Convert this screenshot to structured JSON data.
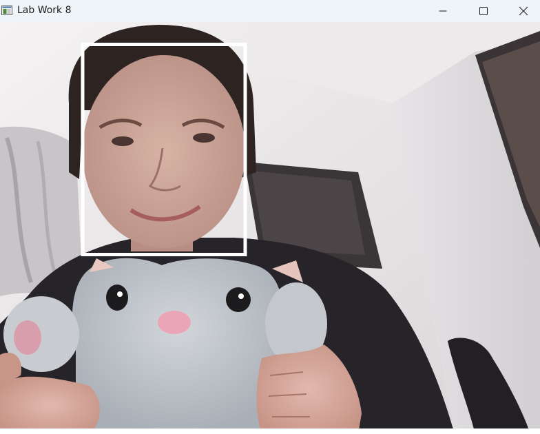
{
  "window": {
    "title": "Lab Work 8",
    "app_icon": "opencv-window-icon",
    "controls": {
      "minimize": "minimize-icon",
      "maximize": "maximize-icon",
      "close": "close-icon"
    }
  },
  "video": {
    "detection_box_color": "#ffffff",
    "detected_objects": [
      "face"
    ]
  }
}
